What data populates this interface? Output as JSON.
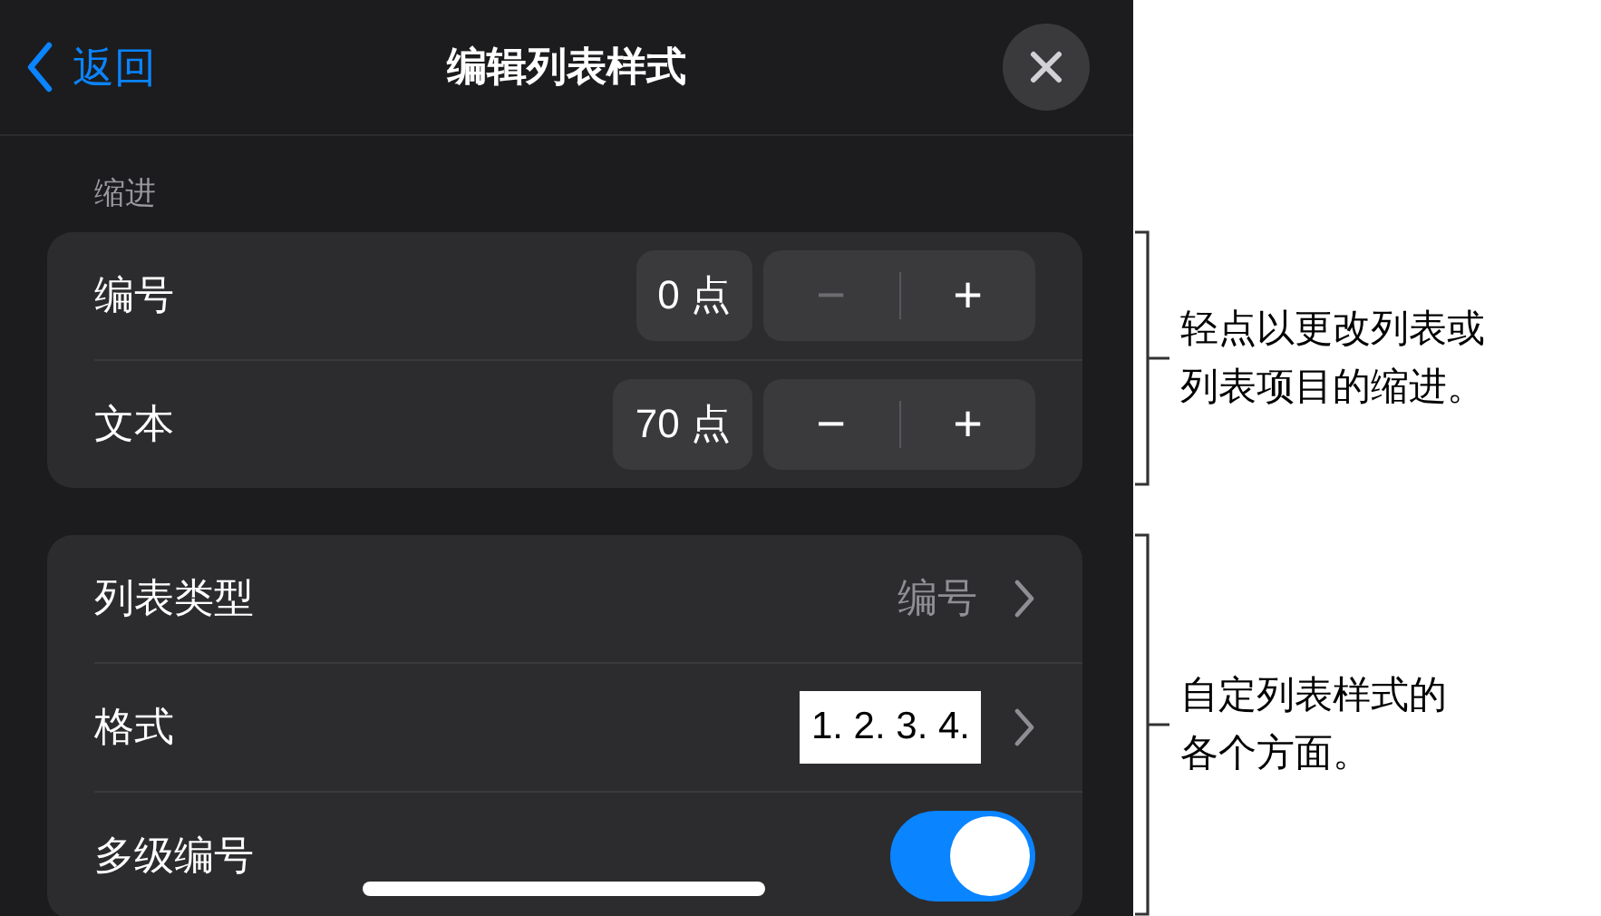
{
  "header": {
    "back": "返回",
    "title": "编辑列表样式"
  },
  "indent_section": {
    "label": "缩进",
    "rows": [
      {
        "label": "编号",
        "value": "0 点",
        "minus": "−",
        "plus": "+",
        "minus_disabled": true
      },
      {
        "label": "文本",
        "value": "70 点",
        "minus": "−",
        "plus": "+",
        "minus_disabled": false
      }
    ]
  },
  "list_section": {
    "rows": [
      {
        "kind": "value",
        "label": "列表类型",
        "value": "编号"
      },
      {
        "kind": "preview",
        "label": "格式",
        "value": "1. 2. 3. 4."
      },
      {
        "kind": "toggle",
        "label": "多级编号",
        "on": true
      }
    ]
  },
  "callouts": [
    {
      "lines": [
        "轻点以更改列表或",
        "列表项目的缩进。"
      ]
    },
    {
      "lines": [
        "自定列表样式的",
        "各个方面。"
      ]
    }
  ]
}
